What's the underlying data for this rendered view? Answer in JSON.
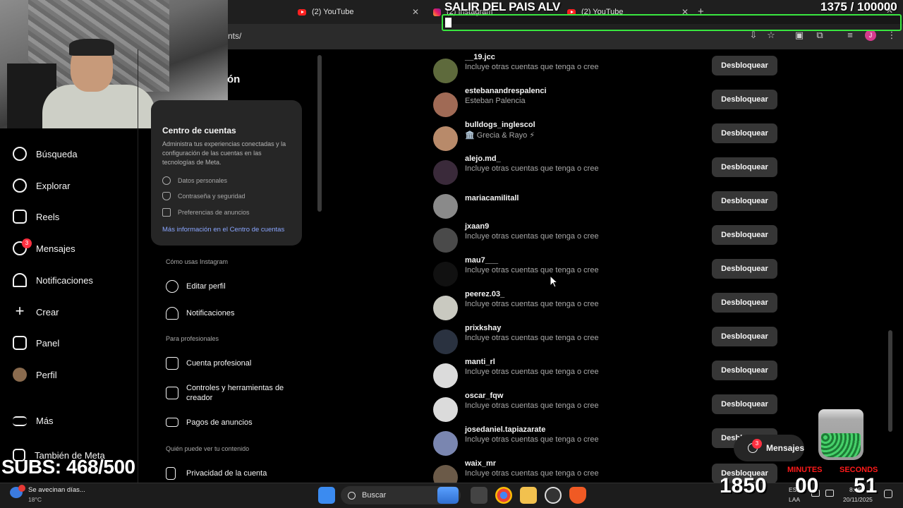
{
  "browser": {
    "tabs": [
      {
        "label": "(2) YouTube",
        "icon": "youtube-icon"
      },
      {
        "label": "(2) Instagram",
        "icon": "instagram-icon"
      },
      {
        "label": "(2) YouTube",
        "icon": "youtube-icon"
      }
    ],
    "url_fragment": "nts/",
    "profile_initial": "J"
  },
  "sidebar": {
    "items": [
      {
        "label": "Búsqueda",
        "icon": "search-icon"
      },
      {
        "label": "Explorar",
        "icon": "compass-icon"
      },
      {
        "label": "Reels",
        "icon": "reels-icon"
      },
      {
        "label": "Mensajes",
        "icon": "messenger-icon",
        "badge": "3"
      },
      {
        "label": "Notificaciones",
        "icon": "heart-icon"
      },
      {
        "label": "Crear",
        "icon": "plus-icon"
      },
      {
        "label": "Panel",
        "icon": "dashboard-icon"
      },
      {
        "label": "Perfil",
        "icon": "avatar"
      }
    ],
    "more": "Más",
    "also_meta": "También de Meta"
  },
  "settings": {
    "header_fragment": "ón",
    "account_center": {
      "title": "Centro de cuentas",
      "description": "Administra tus experiencias conectadas y la configuración de las cuentas en las tecnologías de Meta.",
      "links": [
        "Datos personales",
        "Contraseña y seguridad",
        "Preferencias de anuncios"
      ],
      "more_link": "Más información en el Centro de cuentas"
    },
    "sections": [
      {
        "heading": "Cómo usas Instagram",
        "items": [
          "Editar perfil",
          "Notificaciones"
        ]
      },
      {
        "heading": "Para profesionales",
        "items": [
          "Cuenta profesional",
          "Controles y herramientas de creador",
          "Pagos de anuncios"
        ]
      },
      {
        "heading": "Quién puede ver tu contenido",
        "items": [
          "Privacidad de la cuenta"
        ]
      }
    ]
  },
  "blocked": {
    "button_label": "Desbloquear",
    "accounts": [
      {
        "username": "__19.jcc",
        "subtitle": "Incluye otras cuentas que tenga o cree",
        "color": "#5e6a3c"
      },
      {
        "username": "estebanandrespalenci",
        "subtitle": "Esteban Palencia",
        "color": "#a06a55"
      },
      {
        "username": "bulldogs_inglescol",
        "subtitle": "🏛️ Grecia & Rayo ⚡",
        "color": "#b88a6a"
      },
      {
        "username": "alejo.md_",
        "subtitle": "Incluye otras cuentas que tenga o cree",
        "color": "#3a2a3a"
      },
      {
        "username": "mariacamilitall",
        "subtitle": "",
        "color": "#8a8a8a"
      },
      {
        "username": "jxaan9",
        "subtitle": "Incluye otras cuentas que tenga o cree",
        "color": "#4a4a4a"
      },
      {
        "username": "mau7___",
        "subtitle": "Incluye otras cuentas que tenga o cree",
        "color": "#111111"
      },
      {
        "username": "peerez.03_",
        "subtitle": "Incluye otras cuentas que tenga o cree",
        "color": "#c9c9c0"
      },
      {
        "username": "prixkshay",
        "subtitle": "Incluye otras cuentas que tenga o cree",
        "color": "#2a3240"
      },
      {
        "username": "manti_rl",
        "subtitle": "Incluye otras cuentas que tenga o cree",
        "color": "#dbdbdb"
      },
      {
        "username": "oscar_fqw",
        "subtitle": "Incluye otras cuentas que tenga o cree",
        "color": "#dbdbdb"
      },
      {
        "username": "josedaniel.tapiazarate",
        "subtitle": "Incluye otras cuentas que tenga o cree",
        "color": "#7a86b0"
      },
      {
        "username": "waix_mr",
        "subtitle": "Incluye otras cuentas que tenga o cree",
        "color": "#6b5a48"
      }
    ]
  },
  "messages_pill": {
    "label": "Mensajes",
    "badge": "3"
  },
  "overlay": {
    "goal_title": "SALIR DEL PAIS ALV",
    "goal_count": "1375  / 100000",
    "goal_progress": 0.01375,
    "subs": "SUBS: 468/500",
    "counter": "1850",
    "timer": {
      "hours": "",
      "minutes": "00",
      "seconds": "51",
      "minutes_label": "MINUTES",
      "seconds_label": "SECONDS"
    }
  },
  "taskbar": {
    "weather_text": "Se avecinan días...",
    "weather_temp": "18°C",
    "search_placeholder": "Buscar",
    "lang_top": "ESP",
    "lang_bottom": "LAA",
    "time": "8:45 p. m.",
    "date": "20/11/2025"
  }
}
